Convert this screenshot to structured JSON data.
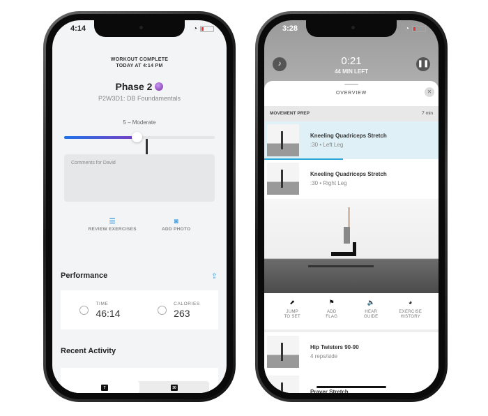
{
  "left_phone": {
    "status_time": "4:14",
    "header_line1": "WORKOUT COMPLETE",
    "header_line2": "TODAY AT 4:14 PM",
    "title": "Phase 2",
    "subtitle": "P2W3D1: DB Foundamentals",
    "effort_label": "5 – Moderate",
    "effort_value": 5,
    "effort_max": 10,
    "comments_placeholder": "Comments for David",
    "actions": [
      {
        "icon": "list-icon",
        "label": "REVIEW EXERCISES"
      },
      {
        "icon": "camera-icon",
        "label": "ADD PHOTO"
      }
    ],
    "performance_title": "Performance",
    "stats": [
      {
        "icon": "stopwatch-icon",
        "label": "TIME",
        "value": "46:14"
      },
      {
        "icon": "flame-icon",
        "label": "CALORIES",
        "value": "263"
      }
    ],
    "recent_title": "Recent Activity",
    "segments": [
      {
        "label": "7",
        "selected": true
      },
      {
        "label": "30",
        "selected": false
      }
    ]
  },
  "right_phone": {
    "status_time": "3:28",
    "timer": "0:21",
    "time_left": "44 MIN LEFT",
    "sheet_title": "OVERVIEW",
    "section": {
      "title": "MOVEMENT PREP",
      "duration": "7 min"
    },
    "exercises_top": [
      {
        "name": "Kneeling Quadriceps Stretch",
        "detail": ":30 • Left Leg",
        "active": true,
        "progress": 0.45
      },
      {
        "name": "Kneeling Quadriceps Stretch",
        "detail": ":30 • Right Leg",
        "active": false
      }
    ],
    "tools": [
      {
        "icon": "jump-icon",
        "line1": "JUMP",
        "line2": "TO SET"
      },
      {
        "icon": "flag-icon",
        "line1": "ADD",
        "line2": "FLAG"
      },
      {
        "icon": "speaker-icon",
        "line1": "HEAR",
        "line2": "GUIDE"
      },
      {
        "icon": "history-icon",
        "line1": "EXERCISE",
        "line2": "HISTORY"
      }
    ],
    "exercises_bottom": [
      {
        "name": "Hip Twisters 90-90",
        "detail": "4 reps/side"
      },
      {
        "name": "Prayer Stretch",
        "detail": ""
      }
    ]
  }
}
